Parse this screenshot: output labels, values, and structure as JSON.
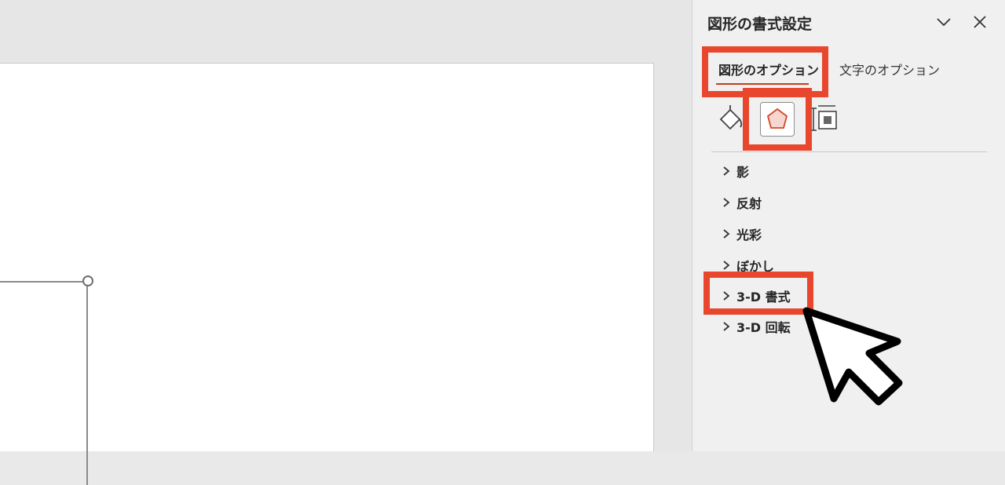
{
  "pane": {
    "title": "図形の書式設定",
    "tabs": [
      {
        "label": "図形のオプション",
        "active": true
      },
      {
        "label": "文字のオプション",
        "active": false
      }
    ],
    "icons": [
      "fill-line-icon",
      "effects-pentagon-icon",
      "size-properties-icon"
    ],
    "sections": [
      {
        "label": "影"
      },
      {
        "label": "反射"
      },
      {
        "label": "光彩"
      },
      {
        "label": "ぼかし"
      },
      {
        "label": "3-D 書式"
      },
      {
        "label": "3-D 回転"
      }
    ]
  },
  "colors": {
    "highlight": "#e8472e",
    "accent_underline": "#c43e1c",
    "pane_bg": "#f0f0f0",
    "slide_bg": "#ffffff"
  }
}
